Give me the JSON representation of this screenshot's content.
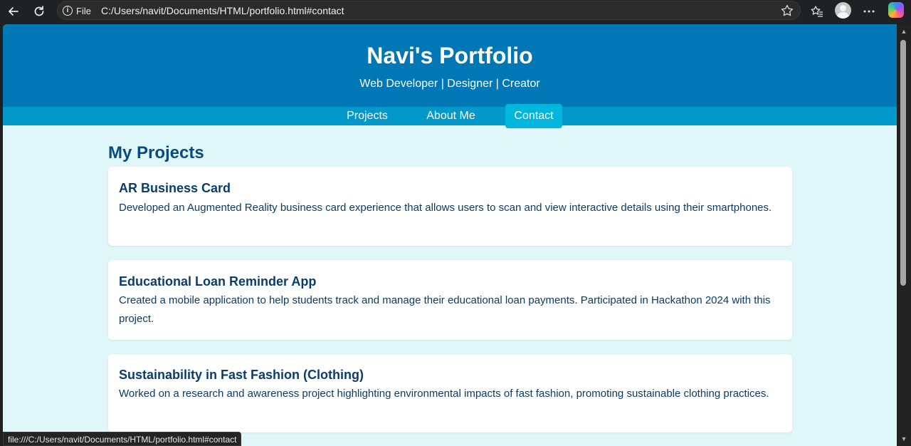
{
  "browser": {
    "info_label": "File",
    "url": "C:/Users/navit/Documents/HTML/portfolio.html#contact",
    "status_url": "file:///C:/Users/navit/Documents/HTML/portfolio.html#contact"
  },
  "header": {
    "title": "Navi's Portfolio",
    "subtitle": "Web Developer | Designer | Creator"
  },
  "nav": {
    "items": [
      {
        "label": "Projects"
      },
      {
        "label": "About Me"
      },
      {
        "label": "Contact",
        "active": true
      }
    ]
  },
  "projects": {
    "heading": "My Projects",
    "items": [
      {
        "title": "AR Business Card",
        "description": "Developed an Augmented Reality business card experience that allows users to scan and view interactive details using their smartphones."
      },
      {
        "title": "Educational Loan Reminder App",
        "description": "Created a mobile application to help students track and manage their educational loan payments. Participated in Hackathon 2024 with this project."
      },
      {
        "title": "Sustainability in Fast Fashion (Clothing)",
        "description": "Worked on a research and awareness project highlighting environmental impacts of fast fashion, promoting sustainable clothing practices."
      }
    ]
  },
  "colors": {
    "header_bg": "#0277b6",
    "nav_bg": "#0298c9",
    "nav_active_bg": "#00b6dc",
    "page_bg": "#e0f7f9",
    "heading_text": "#0a4a7d"
  }
}
